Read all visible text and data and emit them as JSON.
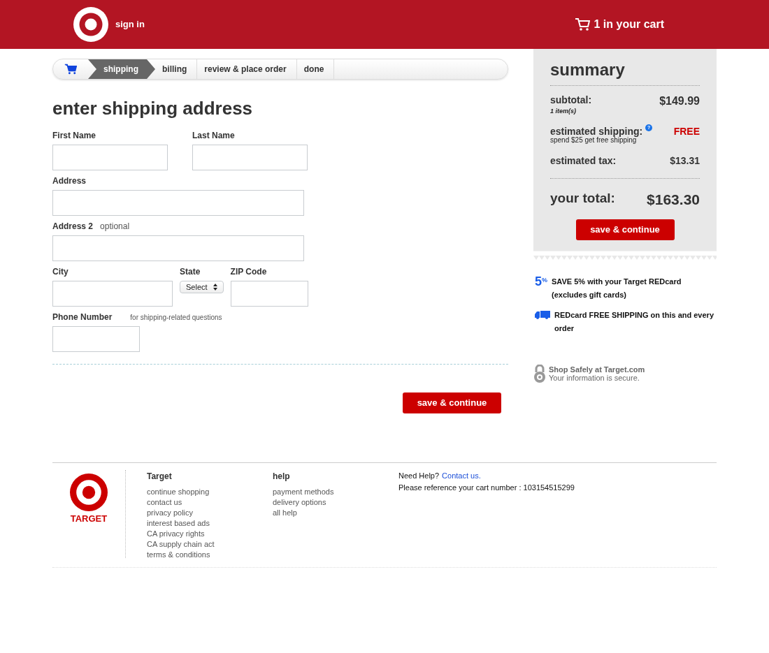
{
  "header": {
    "sign_in": "sign in",
    "cart": "1 in your cart"
  },
  "steps": [
    {
      "label": "shipping",
      "selected": true
    },
    {
      "label": "billing",
      "selected": false
    },
    {
      "label": "review & place order",
      "selected": false
    },
    {
      "label": "done",
      "selected": false
    }
  ],
  "form": {
    "title": "enter shipping address",
    "rows": [
      [
        {
          "kind": "input",
          "label": "First Name"
        },
        {
          "kind": "input",
          "label": "Last Name"
        }
      ],
      [
        {
          "kind": "input",
          "label": "Address"
        }
      ],
      [
        {
          "kind": "input",
          "label": "Address 2",
          "note": "optional"
        }
      ],
      [
        {
          "kind": "input",
          "label": "City"
        },
        {
          "kind": "select",
          "label": "State",
          "value": "Select"
        },
        {
          "kind": "input",
          "label": "ZIP Code"
        }
      ],
      [
        {
          "kind": "input",
          "label": "Phone Number",
          "note": "for shipping-related questions"
        }
      ]
    ],
    "button": "save & continue"
  },
  "summary": {
    "title": "summary",
    "subtotal": {
      "label": "subtotal:",
      "note": "1 item(s)",
      "value": "$149.99"
    },
    "shipping": {
      "label": "estimated shipping:",
      "icon": "?",
      "note": "spend $25 get free shipping",
      "value": "FREE"
    },
    "tax": {
      "label": "estimated tax:",
      "value": "$13.31"
    },
    "total": {
      "label": "your total:",
      "value": "$163.30"
    },
    "button": "save & continue"
  },
  "promos": [
    {
      "kind": "percent",
      "badge": "5$^{%}$",
      "text": "SAVE 5% with your Target REDcard (excludes gift cards)"
    },
    {
      "kind": "truck",
      "text": "REDcard FREE SHIPPING on this and every order"
    }
  ],
  "secure": {
    "title": "Shop Safely at Target.com",
    "text": "Your information is secure."
  },
  "footer": {
    "brand": "TARGET",
    "columns": [
      {
        "title": "Target",
        "links": [
          "continue shopping",
          "contact us",
          "privacy policy",
          "interest based ads",
          "CA privacy rights",
          "CA supply chain act",
          "terms & conditions"
        ]
      },
      {
        "title": "help",
        "links": [
          "payment methods",
          "delivery options",
          "all help"
        ]
      }
    ],
    "help_label": "Need Help?",
    "help_link": "Contact us.",
    "reference": "Please reference your cart number : 103154515299"
  }
}
